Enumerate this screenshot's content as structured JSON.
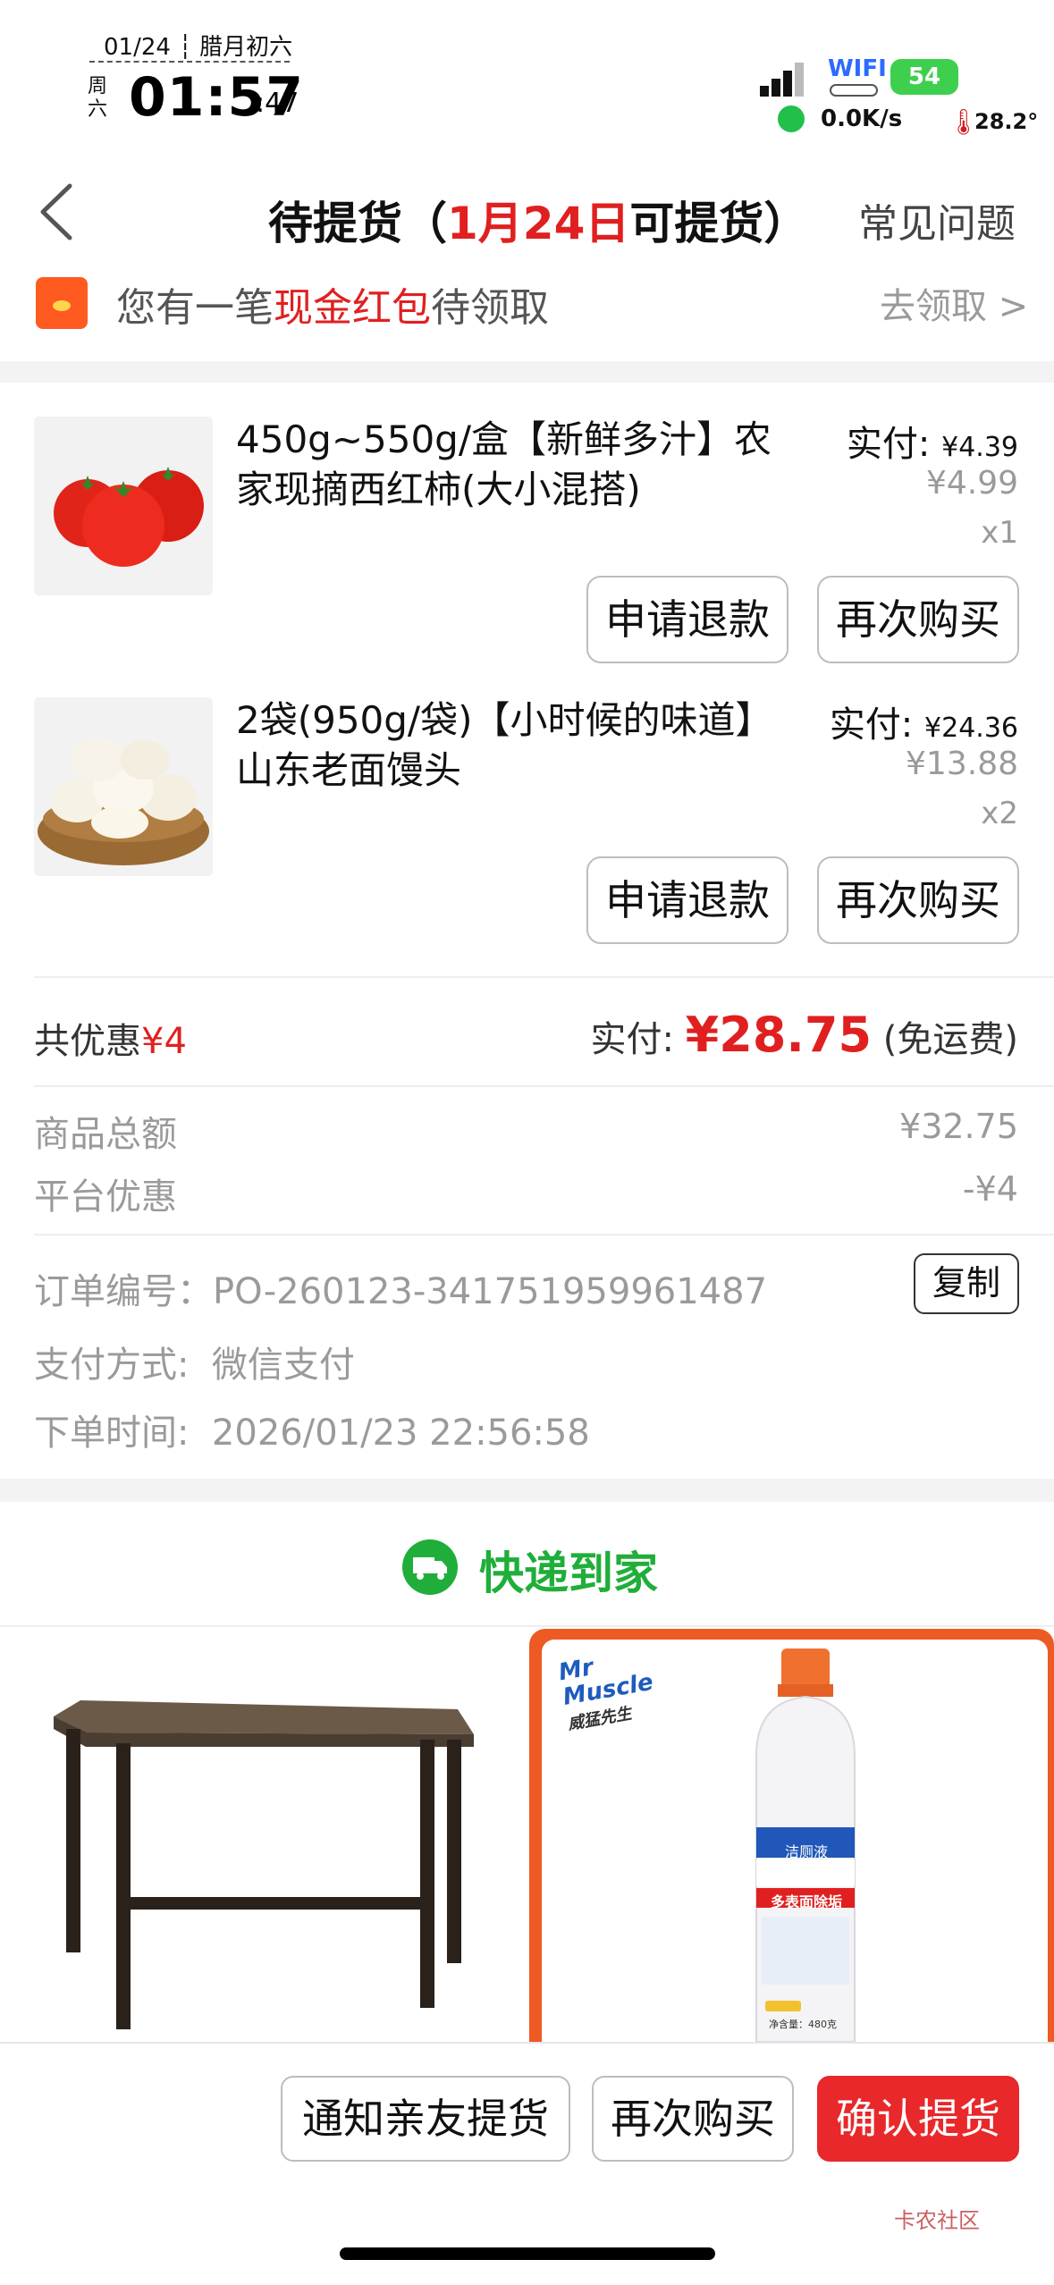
{
  "status_bar": {
    "date": "01/24",
    "lunar": "腊月初六",
    "weekday": "周六",
    "time": "01:57",
    "seconds": ":47",
    "wifi": "WIFI",
    "battery": "54",
    "speed": "0.0K/s",
    "temperature": "28.2°"
  },
  "nav": {
    "title_prefix": "待提货（",
    "title_date": "1月24日",
    "title_suffix": "可提货）",
    "faq": "常见问题"
  },
  "red_packet": {
    "text_prefix": "您有一笔",
    "text_highlight": "现金红包",
    "text_suffix": "待领取",
    "action": "去领取 >"
  },
  "items": [
    {
      "title": "450g~550g/盒【新鲜多汁】农家现摘西红柿(大小混搭)",
      "paid_label": "实付:",
      "paid_value": "¥4.39",
      "original": "¥4.99",
      "qty": "x1",
      "refund": "申请退款",
      "rebuy": "再次购买"
    },
    {
      "title": "2袋(950g/袋)【小时候的味道】山东老面馒头",
      "paid_label": "实付:",
      "paid_value": "¥24.36",
      "original": "¥13.88",
      "qty": "x2",
      "refund": "申请退款",
      "rebuy": "再次购买"
    }
  ],
  "summary": {
    "discount_label": "共优惠",
    "discount_value": "¥4",
    "paid_label": "实付:",
    "paid_value": "¥28.75",
    "shipping": "(免运费)",
    "goods_total_label": "商品总额",
    "goods_total_value": "¥32.75",
    "platform_discount_label": "平台优惠",
    "platform_discount_value": "-¥4"
  },
  "order_info": {
    "number_label": "订单编号：",
    "number_value": "PO-260123-341751959961487",
    "copy": "复制",
    "pay_label": "支付方式:",
    "pay_value": "微信支付",
    "time_label": "下单时间:",
    "time_value": "2026/01/23 22:56:58"
  },
  "express": {
    "title": "快递到家"
  },
  "promo": {
    "brand_badge": "Mr Muscle",
    "brand_cn": "威猛先生",
    "product_name": "洁厕液",
    "product_sub": "多表面除垢",
    "net": "净含量：480克"
  },
  "bottom": {
    "notify": "通知亲友提货",
    "rebuy": "再次购买",
    "confirm": "确认提货"
  },
  "watermark": "卡农社区",
  "colors": {
    "accent_red": "#e02020",
    "express_green": "#1fae3a",
    "promo_orange": "#ee5a24"
  }
}
